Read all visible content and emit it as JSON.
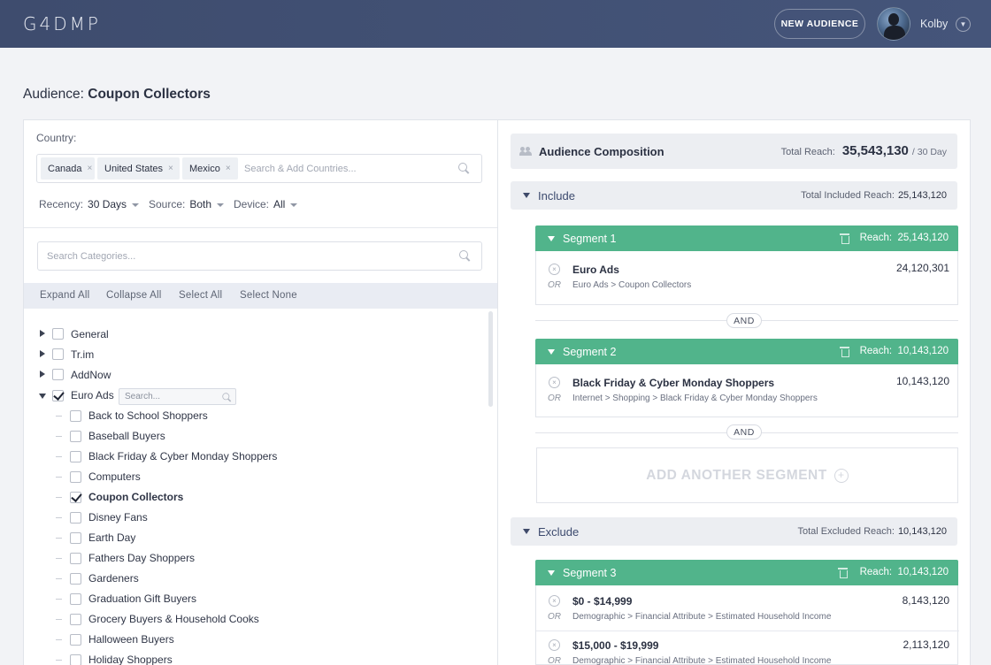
{
  "app": {
    "logo": "G4DMP",
    "new_audience_label": "NEW AUDIENCE",
    "user_name": "Kolby"
  },
  "page": {
    "title_prefix": "Audience:",
    "title_name": "Coupon Collectors"
  },
  "country": {
    "label": "Country:",
    "chips": [
      "Canada",
      "United States",
      "Mexico"
    ],
    "chip_remove": "×",
    "placeholder": "Search & Add Countries..."
  },
  "filters": {
    "recency_label": "Recency:",
    "recency_value": "30 Days",
    "source_label": "Source:",
    "source_value": "Both",
    "device_label": "Device:",
    "device_value": "All"
  },
  "categories": {
    "placeholder": "Search Categories...",
    "toolbar": [
      "Expand All",
      "Collapse All",
      "Select All",
      "Select None"
    ],
    "mini_search_placeholder": "Search...",
    "top_level": [
      {
        "label": "General",
        "expanded": false,
        "checked": false
      },
      {
        "label": "Tr.im",
        "expanded": false,
        "checked": false
      },
      {
        "label": "AddNow",
        "expanded": false,
        "checked": false
      },
      {
        "label": "Euro Ads",
        "expanded": true,
        "checked": true
      }
    ],
    "children": [
      {
        "label": "Back to School Shoppers",
        "checked": false
      },
      {
        "label": "Baseball Buyers",
        "checked": false
      },
      {
        "label": "Black Friday & Cyber Monday Shoppers",
        "checked": false
      },
      {
        "label": "Computers",
        "checked": false
      },
      {
        "label": "Coupon Collectors",
        "checked": true
      },
      {
        "label": "Disney Fans",
        "checked": false
      },
      {
        "label": "Earth Day",
        "checked": false
      },
      {
        "label": "Fathers Day Shoppers",
        "checked": false
      },
      {
        "label": "Gardeners",
        "checked": false
      },
      {
        "label": "Graduation Gift Buyers",
        "checked": false
      },
      {
        "label": "Grocery Buyers & Household Cooks",
        "checked": false
      },
      {
        "label": "Halloween Buyers",
        "checked": false
      },
      {
        "label": "Holiday Shoppers",
        "checked": false
      }
    ]
  },
  "composition": {
    "title": "Audience Composition",
    "total_reach_label": "Total Reach:",
    "total_reach_value": "35,543,130",
    "total_reach_period": "/ 30 Day",
    "include": {
      "title": "Include",
      "reach_label": "Total Included Reach:",
      "reach_value": "25,143,120"
    },
    "exclude": {
      "title": "Exclude",
      "reach_label": "Total Excluded Reach:",
      "reach_value": "10,143,120"
    },
    "and_label": "AND",
    "or_label": "OR",
    "remove_glyph": "×",
    "add_segment_label": "ADD ANOTHER SEGMENT",
    "add_segment_plus": "+",
    "segments": [
      {
        "title": "Segment 1",
        "reach_label": "Reach:",
        "reach_value": "25,143,120",
        "rows": [
          {
            "name": "Euro Ads",
            "path": "Euro Ads > Coupon Collectors",
            "value": "24,120,301"
          }
        ]
      },
      {
        "title": "Segment 2",
        "reach_label": "Reach:",
        "reach_value": "10,143,120",
        "rows": [
          {
            "name": "Black Friday & Cyber Monday Shoppers",
            "path": "Internet  >  Shopping  >  Black Friday & Cyber Monday Shoppers",
            "value": "10,143,120"
          }
        ]
      },
      {
        "title": "Segment 3",
        "reach_label": "Reach:",
        "reach_value": "10,143,120",
        "rows": [
          {
            "name": "$0 - $14,999",
            "path": "Demographic  >  Financial Attribute  >  Estimated Household Income",
            "value": "8,143,120"
          },
          {
            "name": "$15,000 - $19,999",
            "path": "Demographic  >  Financial Attribute  >  Estimated Household Income",
            "value": "2,113,120"
          }
        ]
      }
    ]
  },
  "colors": {
    "header_bg": "#3e4c6e",
    "segment_green": "#51b48b",
    "accent_text": "#3c4a6e"
  }
}
